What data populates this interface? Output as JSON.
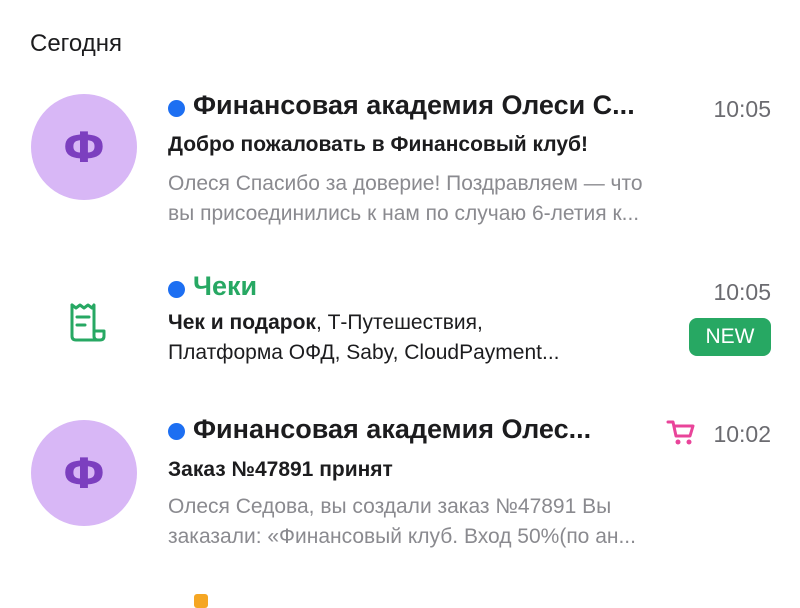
{
  "section": {
    "title": "Сегодня"
  },
  "emails": [
    {
      "avatar_letter": "Ф",
      "sender": "Финансовая академия Олеси С...",
      "time": "10:05",
      "subject": "Добро пожаловать в Финансовый клуб!",
      "preview_line1": "Олеся Спасибо за доверие! Поздравляем — что",
      "preview_line2": "вы присоединились к нам по случаю 6-летия к..."
    },
    {
      "icon": "receipt-icon",
      "sender": "Чеки",
      "sender_color": "#27a863",
      "time": "10:05",
      "line1_bold": "Чек и подарок",
      "line1_rest": ", Т-Путешествия,",
      "line2": "Платформа ОФД, Saby, CloudPayment...",
      "badge": "NEW",
      "badge_color": "#27a863"
    },
    {
      "avatar_letter": "Ф",
      "sender": "Финансовая академия Олес...",
      "time": "10:02",
      "cart_icon": "cart-icon",
      "cart_color": "#e9449a",
      "subject": "Заказ №47891 принят",
      "preview_line1": "Олеся Седова, вы создали заказ №47891 Вы",
      "preview_line2": "заказали: «Финансовый клуб. Вход 50%(по ан..."
    }
  ],
  "colors": {
    "unread_dot": "#1d6ff2",
    "avatar_bg": "#d8b7f6",
    "avatar_text": "#7c3fbf"
  }
}
